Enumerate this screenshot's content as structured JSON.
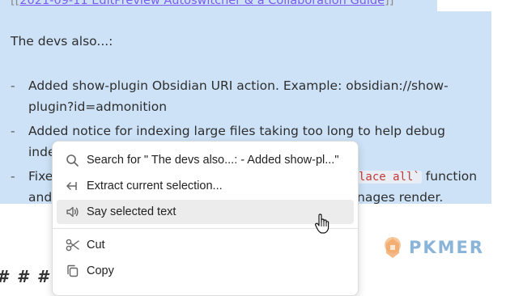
{
  "editor": {
    "link_open": "[[",
    "link_text": "2021-09-11 EditPreview Autoswitcher & a Collaboration Guide",
    "link_close": "]]",
    "intro": "The devs also...:",
    "bullet_marker": "-",
    "items": [
      {
        "line1": "Added show-plugin Obsidian URI action. Example: obsidian://show-",
        "line2": "plugin?id=admonition"
      },
      {
        "line1": "Added notice for indexing large files taking too long to help debug",
        "line2": "inde"
      },
      {
        "line1_a": "Fixe",
        "line1_code": "lace all`",
        "line1_b": " function",
        "line2_a": "and",
        "line2_b": "nages render."
      }
    ],
    "heading_fragment": "# # # F"
  },
  "context_menu": {
    "items": [
      {
        "label": "Search for \" The devs also...: - Added show-pl...\"",
        "icon": "search-icon"
      },
      {
        "label": "Extract current selection...",
        "icon": "extract-icon"
      },
      {
        "label": "Say selected text",
        "icon": "speaker-icon",
        "hovered": true
      },
      {
        "label": "Cut",
        "icon": "scissors-icon"
      },
      {
        "label": "Copy",
        "icon": "copy-icon"
      }
    ]
  },
  "watermark": {
    "text": "PKMER"
  },
  "colors": {
    "selection": "#cde2f7",
    "link": "#7a5cf0",
    "logo": "#8ab4d8",
    "inline_code": "#c03a3a"
  }
}
